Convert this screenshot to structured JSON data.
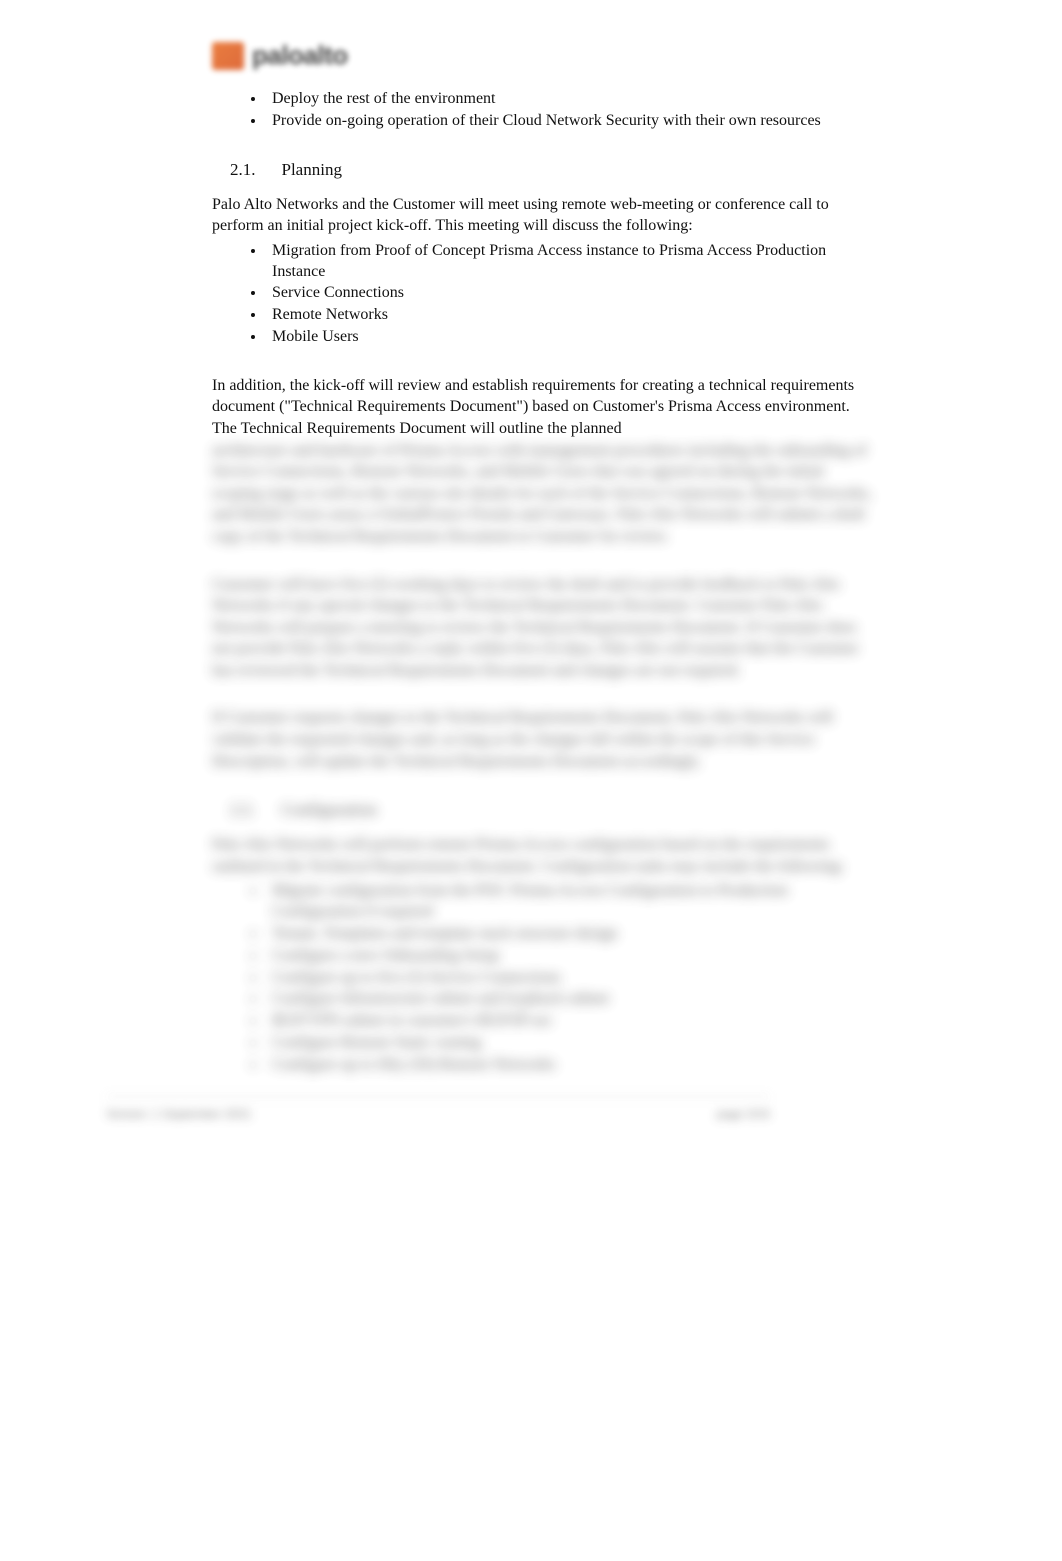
{
  "logo_text": "paloalto",
  "top_bullets": [
    "Deploy the rest of the environment",
    "Provide on-going operation of their Cloud Network Security with their own resources"
  ],
  "section_number": "2.1.",
  "section_title": "Planning",
  "intro_para": "Palo Alto Networks and the Customer will meet using remote web-meeting or conference call to perform an initial project kick-off. This meeting will discuss the following:",
  "planning_bullets": [
    "Migration from Proof of Concept Prisma Access instance to Prisma Access Production Instance",
    "Service Connections",
    "Remote Networks",
    "Mobile Users"
  ],
  "trd_para": "In addition, the kick-off will review and establish requirements for creating a technical requirements document (\"Technical Requirements Document\") based on Customer's Prisma Access environment. The Technical Requirements Document will outline the planned",
  "blur_para1": "architecture and hardware of Prisma Access with management procedures including the onboarding of Service Connections, Remote Networks, and Mobile Users that was agreed on during the initial scoping stage as well as the various site details for each of the Service Connections, Remote Networks, and Mobile Users areas a GlobalProtect Portals and Gateways. Palo Alto Networks will submit a draft copy of the Technical Requirements Document to Customer for review.",
  "blur_para2": "Customer will have five (5) working days to review the draft and to provide feedback to Palo Alto Networks if any special changes to the Technical Requirements Document. Customer Palo Alto Networks will prepare a meeting to review the Technical Requirements Document. If Customer does not provide Palo Alto Networks a reply within five (5) days, Palo Alto will assume that the Customer has reviewed the Technical Requirements Document and changes are not required.",
  "blur_para3": "If Customer requests changes to the Technical Requirements Document, Palo Alto Networks will validate the requested changes and, as long as the changes fall within the scope of this Service Description, will update the Technical Requirements Document accordingly.",
  "blur_section_num": "2.2.",
  "blur_section_title": "Configuration",
  "blur_config_para": "Palo Alto Networks will perform remote Prisma Access configuration based on the requirements outlined in the Technical Requirements Document. Configuration tasks may include the following:",
  "blur_config_bullets": [
    "Migrate configuration from the POC Prisma Access Configuration to Production Configuration if required",
    "Tenant, Templates and template stack structure design",
    "Configure a new Onboarding Setup",
    "Configure up to five (5) Service Connections",
    "Configure Infrastructure subnet and loopback subnet",
    "BGP/VPN subnet in customer's BGP/IP-sec",
    "Configure Remote Static routing",
    "Configure up to fifty (50) Remote Networks"
  ],
  "footer_left": "Version: 1 September 2021",
  "footer_right": "page 3/15"
}
